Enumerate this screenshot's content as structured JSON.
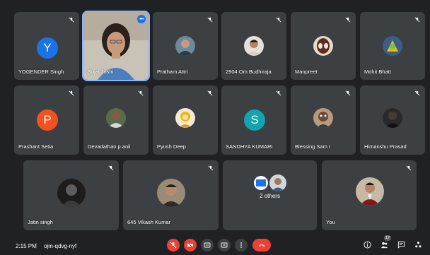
{
  "participants": [
    {
      "name": "YOGENDER Singh",
      "type": "letter",
      "letter": "Y",
      "color": "#1a73e8"
    },
    {
      "name": "Sujal Joshi",
      "type": "video"
    },
    {
      "name": "Pratham Attri",
      "type": "photo"
    },
    {
      "name": "2904 Om Budhiraja",
      "type": "photo"
    },
    {
      "name": "Manpreet",
      "type": "photo"
    },
    {
      "name": "Mohit Bhatt",
      "type": "photo"
    },
    {
      "name": "Prashant Setia",
      "type": "letter",
      "letter": "P",
      "color": "#f4511e"
    },
    {
      "name": "Devadathan p anil",
      "type": "photo"
    },
    {
      "name": "Pyush Deep",
      "type": "photo"
    },
    {
      "name": "SANDHYA KUMARI",
      "type": "letter",
      "letter": "S",
      "color": "#12a4af"
    },
    {
      "name": "Blessing Sam I",
      "type": "photo"
    },
    {
      "name": "Himanshu Prasad",
      "type": "photo"
    },
    {
      "name": "Jatin singh",
      "type": "photo"
    },
    {
      "name": "645 Vikash Kumar",
      "type": "photo"
    },
    {
      "name": "2 others",
      "type": "others"
    },
    {
      "name": "You",
      "type": "photo"
    }
  ],
  "bottombar": {
    "time": "2:15 PM",
    "separator": "|",
    "meeting_code": "ojm-qdvg-nyf",
    "participant_count": "17"
  },
  "colors": {
    "background": "#202124",
    "tile": "#3c4043",
    "danger": "#ea4335"
  }
}
